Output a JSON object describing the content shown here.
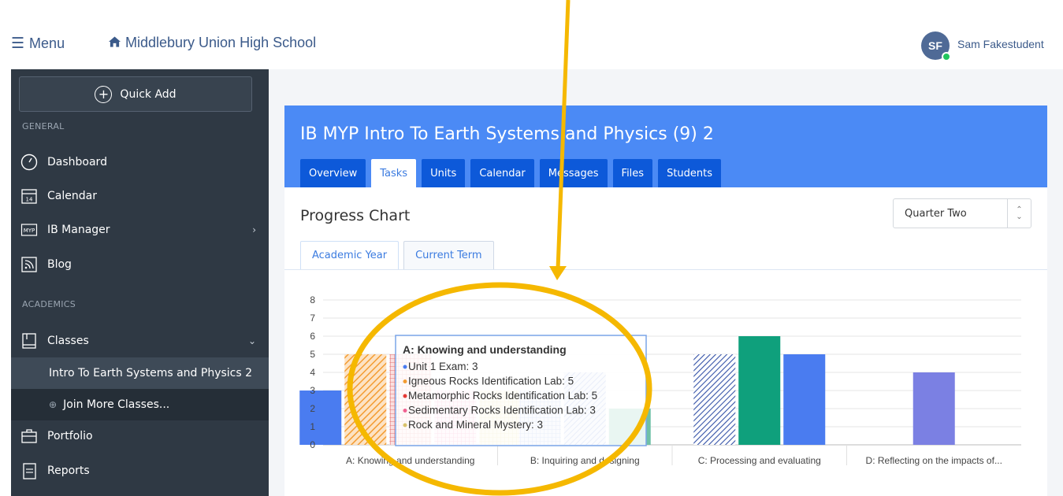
{
  "topbar": {
    "menu_label": "Menu",
    "school_name": "Middlebury Union High School",
    "avatar_initials": "SF",
    "user_name": "Sam Fakestudent"
  },
  "sidebar": {
    "quick_add": "Quick Add",
    "general_label": "GENERAL",
    "academics_label": "ACADEMICS",
    "items": {
      "dashboard": "Dashboard",
      "calendar": "Calendar",
      "calendar_icon_num": "14",
      "ib_manager": "IB Manager",
      "ib_icon_text": "MYP",
      "blog": "Blog",
      "classes": "Classes",
      "class_active": "Intro To Earth Systems and Physics 2",
      "join_more": "Join More Classes...",
      "portfolio": "Portfolio",
      "reports": "Reports"
    }
  },
  "course": {
    "title": "IB MYP Intro To Earth Systems and Physics (9) 2",
    "tabs": [
      "Overview",
      "Tasks",
      "Units",
      "Calendar",
      "Messages",
      "Files",
      "Students"
    ],
    "active_tab": "Tasks"
  },
  "progress": {
    "title": "Progress Chart",
    "term_select": "Quarter Two",
    "subtabs": [
      "Academic Year",
      "Current Term"
    ],
    "active_subtab": "Academic Year"
  },
  "chart_data": {
    "type": "bar",
    "categories": [
      "A: Knowing and understanding",
      "B: Inquiring and designing",
      "C: Processing and evaluating",
      "D: Reflecting on the impacts of..."
    ],
    "ylim": [
      0,
      8
    ],
    "yticks": [
      0,
      1,
      2,
      3,
      4,
      5,
      6,
      7,
      8
    ],
    "grid": true,
    "groups": [
      {
        "category": "A: Knowing and understanding",
        "bars": [
          {
            "value": 3,
            "color": "#4a7cf0",
            "pattern": "solid"
          },
          {
            "value": 5,
            "color": "#f39c32",
            "pattern": "diag"
          },
          {
            "value": 5,
            "color": "#e57373",
            "pattern": "grid"
          },
          {
            "value": 3,
            "color": "#f06292",
            "pattern": "grid"
          },
          {
            "value": 3,
            "color": "#d9c26b",
            "pattern": "grid"
          }
        ]
      },
      {
        "category": "B: Inquiring and designing",
        "bars": [
          {
            "value": 3,
            "color": "#6b8ad8",
            "pattern": "grid"
          },
          {
            "value": 4,
            "color": "#6b8ad8",
            "pattern": "diag"
          },
          {
            "value": 2,
            "color": "#6fc0a6",
            "pattern": "solid"
          }
        ]
      },
      {
        "category": "C: Processing and evaluating",
        "bars": [
          {
            "value": 5,
            "color": "#3553a8",
            "pattern": "diag"
          },
          {
            "value": 6,
            "color": "#0fa07c",
            "pattern": "solid"
          },
          {
            "value": 5,
            "color": "#4a7cf0",
            "pattern": "solid"
          }
        ]
      },
      {
        "category": "D: Reflecting on the impacts of...",
        "bars": [
          {
            "value": 4,
            "color": "#7b80e3",
            "pattern": "solid"
          }
        ]
      }
    ],
    "tooltip": {
      "title": "A: Knowing and understanding",
      "entries": [
        {
          "label": "Unit 1 Exam: 3",
          "color": "#4a7cf0"
        },
        {
          "label": "Igneous Rocks Identification Lab: 5",
          "color": "#f39c32"
        },
        {
          "label": "Metamorphic Rocks Identification Lab: 5",
          "color": "#e53935"
        },
        {
          "label": "Sedimentary Rocks Identification Lab: 3",
          "color": "#f06292"
        },
        {
          "label": "Rock and Mineral Mystery: 3",
          "color": "#d9c26b"
        }
      ]
    }
  },
  "colors": {
    "brand_blue": "#4b8af5",
    "tab_blue": "#0d59d9",
    "sidebar_bg": "#2f3944",
    "annotation": "#f5b800"
  }
}
